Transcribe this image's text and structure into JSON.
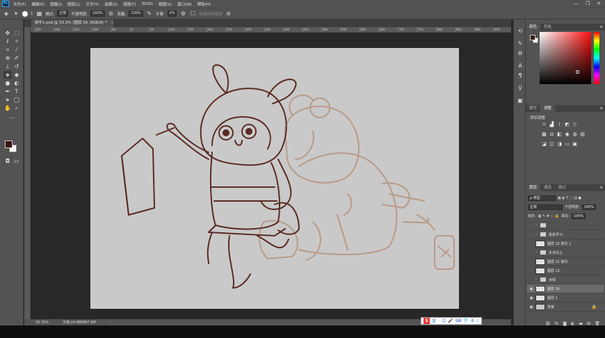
{
  "app": {
    "logo": "Ps"
  },
  "menu": [
    "文件(F)",
    "编辑(E)",
    "图像(I)",
    "图层(L)",
    "文字(Y)",
    "选择(S)",
    "滤镜(T)",
    "3D(D)",
    "视图(V)",
    "窗口(W)",
    "帮助(H)"
  ],
  "window_controls": {
    "minimize": "—",
    "maximize": "❐",
    "close": "✕"
  },
  "options": {
    "brush_size": "1",
    "mode_label": "模式:",
    "mode_value": "正常",
    "opacity_label": "不透明度:",
    "opacity_value": "100%",
    "flow_label": "流量:",
    "flow_value": "100%",
    "smoothing_label": "平滑:",
    "smoothing_value": "0%",
    "sample_label": "绘画对称选项"
  },
  "document": {
    "tab_title": "新年1.psd @ 33.3% (图层 56, RGB/8) *",
    "tab_close": "×",
    "ruler_ticks": [
      "250",
      "200",
      "150",
      "100",
      "50",
      "0",
      "50",
      "100",
      "150",
      "200",
      "250",
      "300",
      "350",
      "400",
      "450",
      "500",
      "550",
      "600",
      "650",
      "700",
      "750",
      "800",
      "850",
      "900",
      "950",
      "1000"
    ]
  },
  "status": {
    "zoom": "33.33%",
    "doc_size": "文档:24.9M/867.9M",
    "arrow": "›"
  },
  "colors": {
    "foreground": "#3a1410",
    "background": "#ffffff",
    "sketch_dark": "#5a2a22",
    "sketch_light": "#b99a87",
    "canvas": "#c9c9c9"
  },
  "color_panel": {
    "tabs": [
      "颜色",
      "色板"
    ]
  },
  "adjust_panel": {
    "tabs": [
      "属性",
      "调整"
    ],
    "add_label": "添加调整"
  },
  "layers_panel": {
    "tabs": [
      "图层",
      "通道",
      "路径"
    ],
    "filter_label": "ρ 类型",
    "blend_mode": "正常",
    "opacity_label": "不透明度:",
    "opacity_value": "100%",
    "lock_label": "锁定:",
    "fill_label": "填充:",
    "fill_value": "100%",
    "layers": [
      {
        "name": "",
        "kind": "folder",
        "visible": false,
        "selected": false
      },
      {
        "name": "投投学习",
        "kind": "folder",
        "visible": false,
        "selected": false
      },
      {
        "name": "图层 22 拷贝 2",
        "kind": "layer",
        "visible": false,
        "selected": false
      },
      {
        "name": "天天向上",
        "kind": "folder",
        "visible": false,
        "selected": false
      },
      {
        "name": "图层 22 拷贝",
        "kind": "layer",
        "visible": false,
        "selected": false
      },
      {
        "name": "图层 22",
        "kind": "layer",
        "visible": false,
        "selected": false
      },
      {
        "name": "点线",
        "kind": "folder",
        "visible": false,
        "selected": false
      },
      {
        "name": "图层 56",
        "kind": "layer",
        "visible": true,
        "selected": true
      },
      {
        "name": "图层 2",
        "kind": "layer",
        "visible": true,
        "selected": false
      },
      {
        "name": "背景",
        "kind": "background",
        "visible": true,
        "selected": false
      }
    ],
    "bottom_icons": [
      "link-icon",
      "fx-icon",
      "mask-icon",
      "adjustment-icon",
      "group-icon",
      "new-layer-icon",
      "trash-icon"
    ]
  },
  "ime": {
    "logo": "S",
    "lang": "英",
    "icons": [
      "·",
      "☺",
      "🎤",
      "⌨",
      "👕",
      "⚙",
      "⁝⁝"
    ]
  }
}
